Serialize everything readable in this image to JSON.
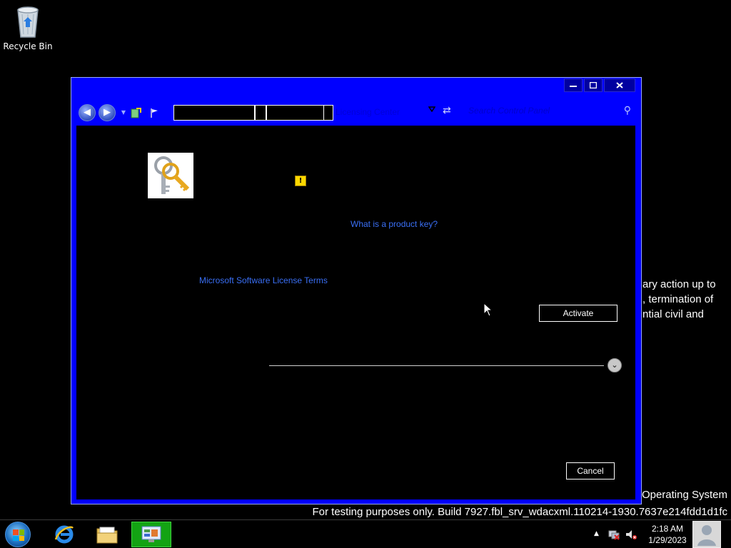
{
  "desktop": {
    "recycle_bin_label": "Recycle Bin",
    "legal_lines": [
      "ary action up to",
      ", termination of",
      "ntial civil and"
    ],
    "os_line": "Operating System",
    "build_line": "For testing purposes only. Build 7927.fbl_srv_wdacxml.110214-1930.7637e214fdd1d1fc"
  },
  "window": {
    "address_crumb": "Licensing Center",
    "search_placeholder": "Search Control Panel",
    "product_key_link": "What is a product key?",
    "license_terms_link": "Microsoft Software License Terms",
    "activate_label": "Activate",
    "cancel_label": "Cancel",
    "warning_glyph": "!"
  },
  "taskbar": {
    "time": "2:18 AM",
    "date": "1/29/2023"
  },
  "colors": {
    "window_frame": "#0000ff",
    "link": "#3a6ff5",
    "active_task": "#13a313"
  }
}
